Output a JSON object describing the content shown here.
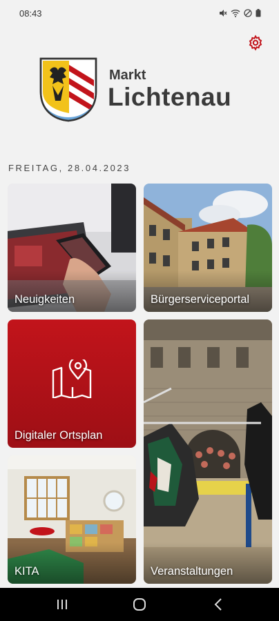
{
  "status_bar": {
    "time": "08:43",
    "icons": [
      "mute-icon",
      "wifi-icon",
      "dnd-icon",
      "battery-icon"
    ]
  },
  "header": {
    "settings_icon": "gear-icon",
    "town_prefix": "Markt",
    "town_name": "Lichtenau"
  },
  "date_line": "FREITAG, 28.04.2023",
  "tiles": {
    "news": {
      "label": "Neuigkeiten"
    },
    "portal": {
      "label": "Bürgerserviceportal"
    },
    "map": {
      "label": "Digitaler Ortsplan",
      "icon": "map-pin-icon"
    },
    "events": {
      "label": "Veranstaltungen"
    },
    "kita": {
      "label": "KITA"
    }
  },
  "nav_bar": {
    "recent": "recent-apps-icon",
    "home": "home-icon",
    "back": "back-icon"
  },
  "colors": {
    "accent": "#c2141b",
    "background": "#f2f2f2",
    "text": "#3a3a3a"
  }
}
